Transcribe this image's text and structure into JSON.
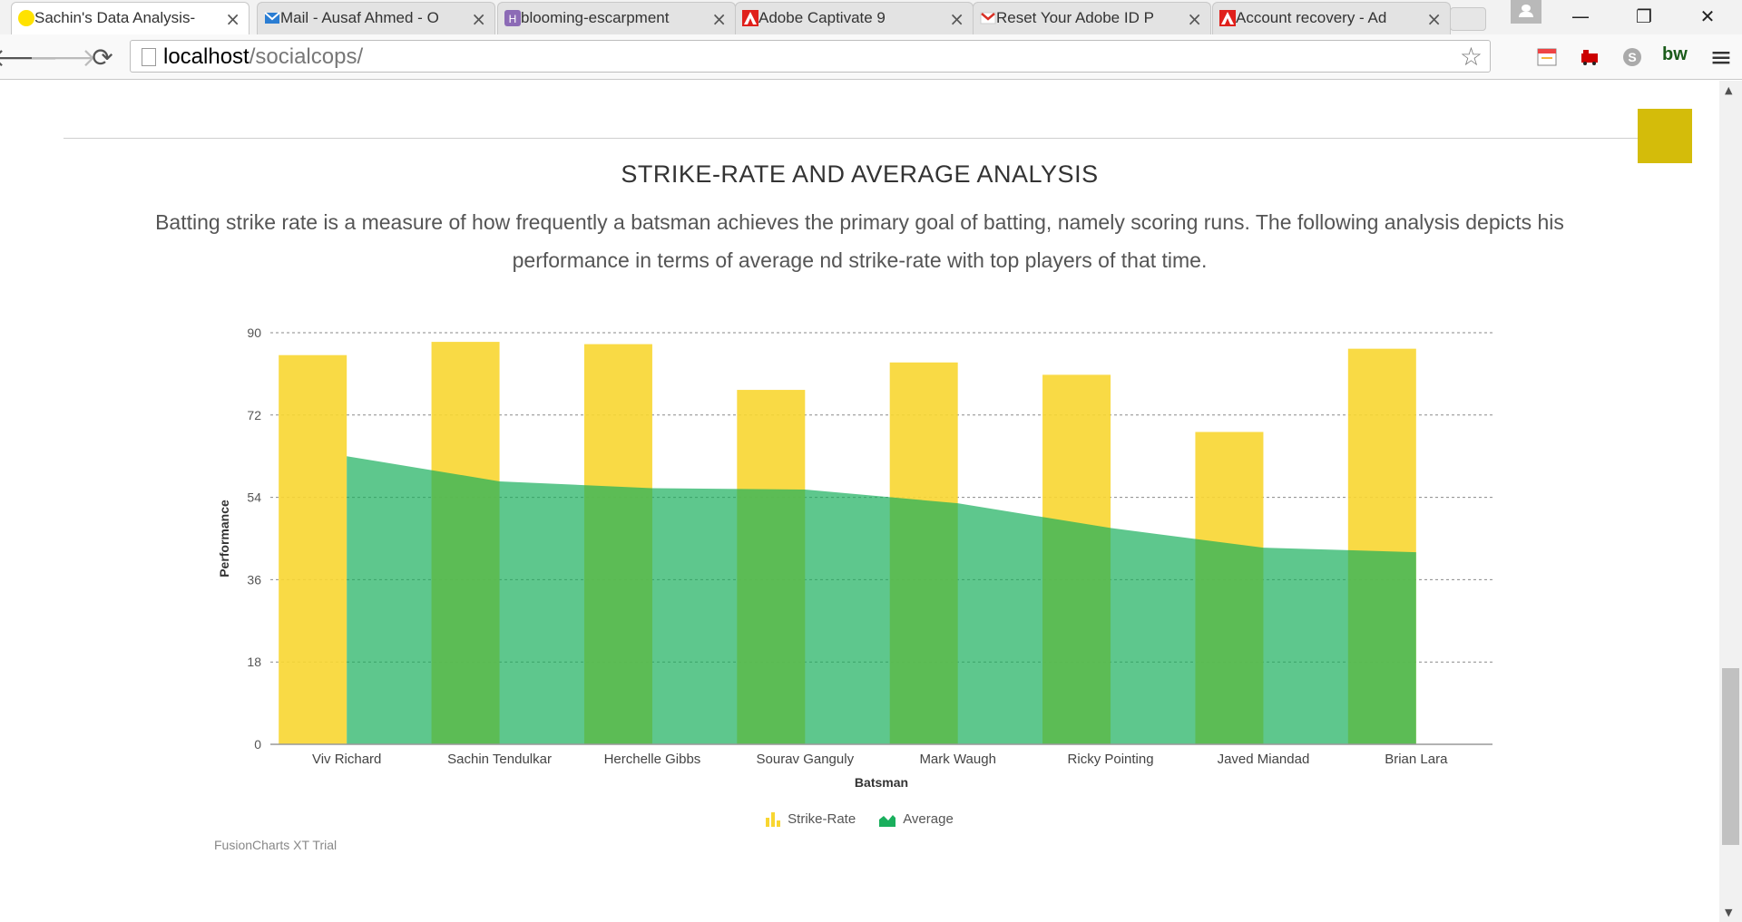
{
  "browser": {
    "tabs": [
      {
        "title": "Sachin's Data Analysis-",
        "icon": "yellow-circle-icon",
        "active": true
      },
      {
        "title": "Mail - Ausaf Ahmed - O",
        "icon": "mail-icon",
        "active": false
      },
      {
        "title": "blooming-escarpment",
        "icon": "heroku-icon",
        "active": false
      },
      {
        "title": "Adobe Captivate 9",
        "icon": "adobe-icon",
        "active": false
      },
      {
        "title": "Reset Your Adobe ID P",
        "icon": "gmail-icon",
        "active": false
      },
      {
        "title": "Account recovery - Ad",
        "icon": "adobe-icon",
        "active": false
      }
    ],
    "close_glyph": "×",
    "url_host": "localhost",
    "url_path": "/socialcops/",
    "back_glyph": "🡐",
    "forward_glyph": "🡒",
    "reload_glyph": "⟳",
    "star_glyph": "☆",
    "minimize_glyph": "—",
    "restore_glyph": "❐",
    "window_close_glyph": "✕",
    "menu_glyph": "≡",
    "ext_bw_label": "bw"
  },
  "section": {
    "title": "STRIKE-RATE AND AVERAGE ANALYSIS",
    "description": "Batting strike rate is a measure of how frequently a batsman achieves the primary goal of batting, namely scoring runs. The following analysis depicts his performance in terms of average nd strike-rate with top players of that time."
  },
  "chart_data": {
    "type": "bar",
    "categories": [
      "Viv Richard",
      "Sachin Tendulkar",
      "Herchelle Gibbs",
      "Sourav Ganguly",
      "Mark Waugh",
      "Ricky Pointing",
      "Javed Miandad",
      "Brian Lara"
    ],
    "series": [
      {
        "name": "Strike-Rate",
        "type": "bar",
        "color": "#f8d631",
        "values": [
          85.1,
          88.0,
          87.5,
          77.5,
          83.5,
          80.8,
          68.3,
          86.5
        ]
      },
      {
        "name": "Average",
        "type": "area",
        "color": "#1aaf5d",
        "values": [
          63.0,
          57.5,
          56.0,
          55.7,
          52.7,
          47.3,
          43.0,
          42.0
        ]
      }
    ],
    "xlabel": "Batsman",
    "ylabel": "Performance",
    "ylim": [
      0,
      90
    ],
    "yticks": [
      0,
      18,
      36,
      54,
      72,
      90
    ],
    "grid": true,
    "legend_placement": "bottom-center"
  },
  "watermark": "FusionCharts XT Trial",
  "scrollbar": {
    "up_glyph": "▲",
    "down_glyph": "▼"
  }
}
